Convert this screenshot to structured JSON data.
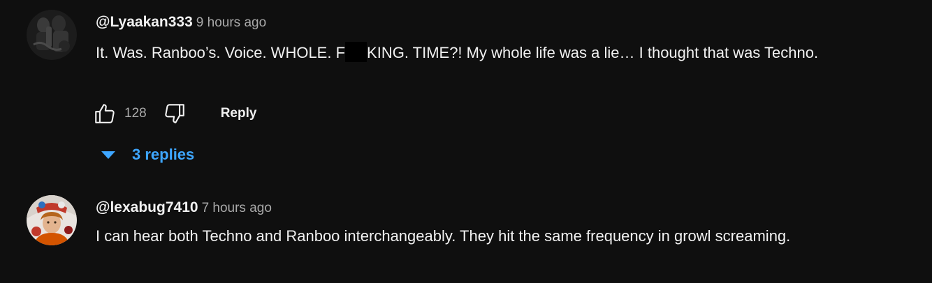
{
  "comments": [
    {
      "author": "@Lyaakan333",
      "timestamp": "9 hours ago",
      "text_before_redaction": "It. Was. Ranboo’s. Voice.  WHOLE. F",
      "text_after_redaction": "KING. TIME?! My whole life was a lie… I thought that was Techno.",
      "likes": "128",
      "reply_label": "Reply",
      "replies_label": "3 replies",
      "icons": {
        "avatar": "avatar-dark-figure",
        "like": "thumbs-up-icon",
        "dislike": "thumbs-down-icon",
        "expand": "triangle-down-icon"
      }
    },
    {
      "author": "@lexabug7410",
      "timestamp": "7 hours ago",
      "text": "I can hear both Techno and Ranboo interchangeably. They hit the same frequency in growl screaming.",
      "icons": {
        "avatar": "avatar-colorful-person"
      }
    }
  ],
  "colors": {
    "background": "#0f0f0f",
    "primary_text": "#f1f1f1",
    "secondary_text": "#aaaaaa",
    "link_blue": "#3ea6ff"
  }
}
